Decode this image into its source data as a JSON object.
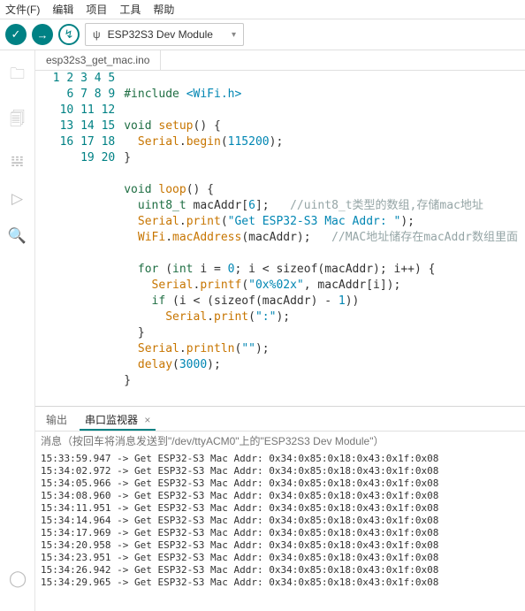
{
  "menu": {
    "file": "文件(F)",
    "edit": "编辑",
    "project": "项目",
    "tool": "工具",
    "help": "帮助"
  },
  "toolbar": {
    "verify_glyph": "✓",
    "upload_glyph": "→",
    "debug_glyph": "↯",
    "usb_glyph": "ψ",
    "board_label": "ESP32S3 Dev Module",
    "chev_glyph": "▾"
  },
  "rail": {
    "folder": "🗀",
    "sketchbook": "🗐",
    "library": "𝍐",
    "debug": "▷",
    "search": "🔍",
    "account": "◯"
  },
  "tab": {
    "filename": "esp32s3_get_mac.ino"
  },
  "code": {
    "numbers": [
      "1",
      "2",
      "3",
      "4",
      "5",
      "6",
      "7",
      "8",
      "9",
      "10",
      "11",
      "12",
      "13",
      "14",
      "15",
      "16",
      "17",
      "18",
      "19",
      "20"
    ],
    "l1_include": "#include",
    "l1_header": "<WiFi.h>",
    "l3_void": "void",
    "l3_setup": "setup",
    "l3_paren": "() {",
    "l4_obj": "Serial",
    "l4_dot": ".",
    "l4_begin": "begin",
    "l4_open": "(",
    "l4_arg": "115200",
    "l4_close": ");",
    "l5_close": "}",
    "l7_void": "void",
    "l7_loop": "loop",
    "l7_paren": "() {",
    "l8_type": "uint8_t",
    "l8_var": " macAddr[",
    "l8_six": "6",
    "l8_close": "];",
    "l8_cmt": "   //uint8_t类型的数组,存储mac地址",
    "l9_obj": "Serial",
    "l9_dot": ".",
    "l9_print": "print",
    "l9_open": "(",
    "l9_str": "\"Get ESP32-S3 Mac Addr: \"",
    "l9_close": ");",
    "l10_obj": "WiFi",
    "l10_dot": ".",
    "l10_mac": "macAddress",
    "l10_open": "(macAddr);",
    "l10_cmt": "   //MAC地址储存在macAddr数组里面",
    "l12_for": "for",
    "l12_open": " (",
    "l12_int": "int",
    "l12_body": " i = ",
    "l12_zero": "0",
    "l12_cond": "; i < sizeof(macAddr); i++) {",
    "l13_obj": "Serial",
    "l13_dot": ".",
    "l13_pf": "printf",
    "l13_open": "(",
    "l13_fmt": "\"0x%02x\"",
    "l13_rest": ", macAddr[i]);",
    "l14_if": "if",
    "l14_body": " (i < (sizeof(macAddr) - ",
    "l14_one": "1",
    "l14_close": "))",
    "l15_obj": "Serial",
    "l15_dot": ".",
    "l15_print": "print",
    "l15_open": "(",
    "l15_colon": "\":\"",
    "l15_close": ");",
    "l16_close": "}",
    "l17_obj": "Serial",
    "l17_dot": ".",
    "l17_pln": "println",
    "l17_open": "(",
    "l17_empty": "\"\"",
    "l17_close": ");",
    "l18_delay": "delay",
    "l18_open": "(",
    "l18_val": "3000",
    "l18_close": ");",
    "l19_close": "}"
  },
  "bottom": {
    "tab_output": "输出",
    "tab_serial": "串口监视器",
    "close_glyph": "×",
    "input_placeholder": "消息（按回车将消息发送到\"/dev/ttyACM0\"上的\"ESP32S3 Dev Module\"）",
    "lines": [
      "15:33:59.947 -> Get ESP32-S3 Mac Addr: 0x34:0x85:0x18:0x43:0x1f:0x08",
      "15:34:02.972 -> Get ESP32-S3 Mac Addr: 0x34:0x85:0x18:0x43:0x1f:0x08",
      "15:34:05.966 -> Get ESP32-S3 Mac Addr: 0x34:0x85:0x18:0x43:0x1f:0x08",
      "15:34:08.960 -> Get ESP32-S3 Mac Addr: 0x34:0x85:0x18:0x43:0x1f:0x08",
      "15:34:11.951 -> Get ESP32-S3 Mac Addr: 0x34:0x85:0x18:0x43:0x1f:0x08",
      "15:34:14.964 -> Get ESP32-S3 Mac Addr: 0x34:0x85:0x18:0x43:0x1f:0x08",
      "15:34:17.969 -> Get ESP32-S3 Mac Addr: 0x34:0x85:0x18:0x43:0x1f:0x08",
      "15:34:20.958 -> Get ESP32-S3 Mac Addr: 0x34:0x85:0x18:0x43:0x1f:0x08",
      "15:34:23.951 -> Get ESP32-S3 Mac Addr: 0x34:0x85:0x18:0x43:0x1f:0x08",
      "15:34:26.942 -> Get ESP32-S3 Mac Addr: 0x34:0x85:0x18:0x43:0x1f:0x08",
      "15:34:29.965 -> Get ESP32-S3 Mac Addr: 0x34:0x85:0x18:0x43:0x1f:0x08"
    ]
  }
}
